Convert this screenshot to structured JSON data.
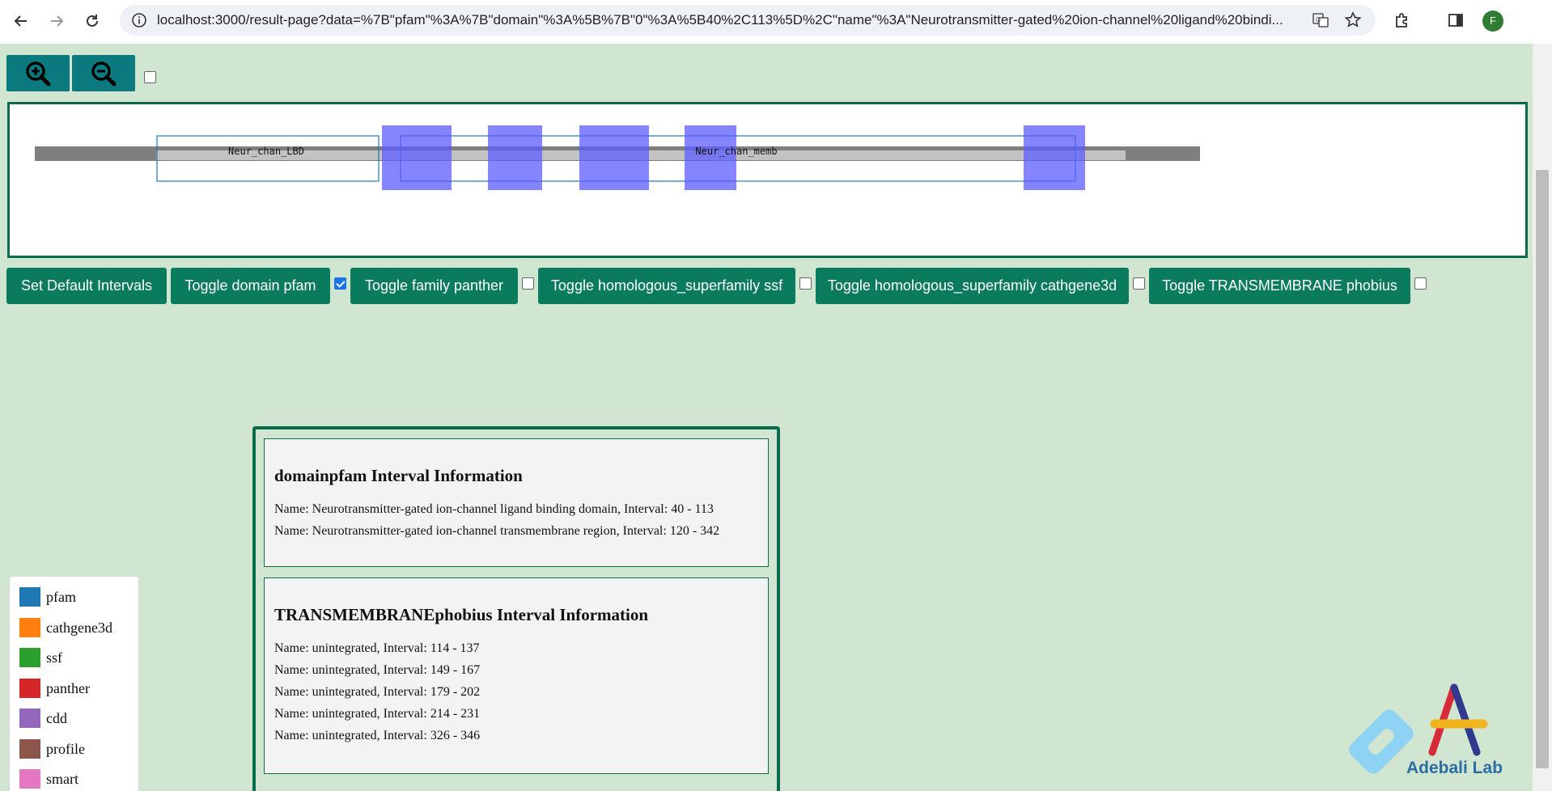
{
  "browser": {
    "url": "localhost:3000/result-page?data=%7B\"pfam\"%3A%7B\"domain\"%3A%5B%7B\"0\"%3A%5B40%2C113%5D%2C\"name\"%3A\"Neurotransmitter-gated%20ion-channel%20ligand%20bindi...",
    "profile_initial": "F"
  },
  "viz": {
    "domain_labels": [
      "Neur_chan_LBD",
      "Neur_chan_memb"
    ]
  },
  "toolbar": {
    "set_default_label": "Set Default Intervals",
    "toggles": [
      {
        "label": "Toggle domain pfam",
        "checked": true
      },
      {
        "label": "Toggle family panther",
        "checked": false
      },
      {
        "label": "Toggle homologous_superfamily ssf",
        "checked": false
      },
      {
        "label": "Toggle homologous_superfamily cathgene3d",
        "checked": false
      },
      {
        "label": "Toggle TRANSMEMBRANE phobius",
        "checked": false
      }
    ]
  },
  "info": {
    "cards": [
      {
        "title": "domainpfam Interval Information",
        "lines": [
          "Name: Neurotransmitter-gated ion-channel ligand binding domain, Interval: 40 - 113",
          "Name: Neurotransmitter-gated ion-channel transmembrane region, Interval: 120 - 342"
        ]
      },
      {
        "title": "TRANSMEMBRANEphobius Interval Information",
        "lines": [
          "Name: unintegrated, Interval: 114 - 137",
          "Name: unintegrated, Interval: 149 - 167",
          "Name: unintegrated, Interval: 179 - 202",
          "Name: unintegrated, Interval: 214 - 231",
          "Name: unintegrated, Interval: 326 - 346"
        ]
      }
    ]
  },
  "legend": {
    "items": [
      {
        "label": "pfam",
        "color": "#1f77b4"
      },
      {
        "label": "cathgene3d",
        "color": "#ff7f0e"
      },
      {
        "label": "ssf",
        "color": "#2ca02c"
      },
      {
        "label": "panther",
        "color": "#d62728"
      },
      {
        "label": "cdd",
        "color": "#9467bd"
      },
      {
        "label": "profile",
        "color": "#8c564b"
      },
      {
        "label": "smart",
        "color": "#e377c2"
      }
    ]
  },
  "logo": {
    "text": "Adebali Lab"
  },
  "colors": {
    "page_bg": "#d0e6d1",
    "accent": "#0a7b5d",
    "zoom_button": "#0b7a7f",
    "transmembrane_fill": "#5c5cff",
    "pfam_outline": "#1f77b4"
  }
}
